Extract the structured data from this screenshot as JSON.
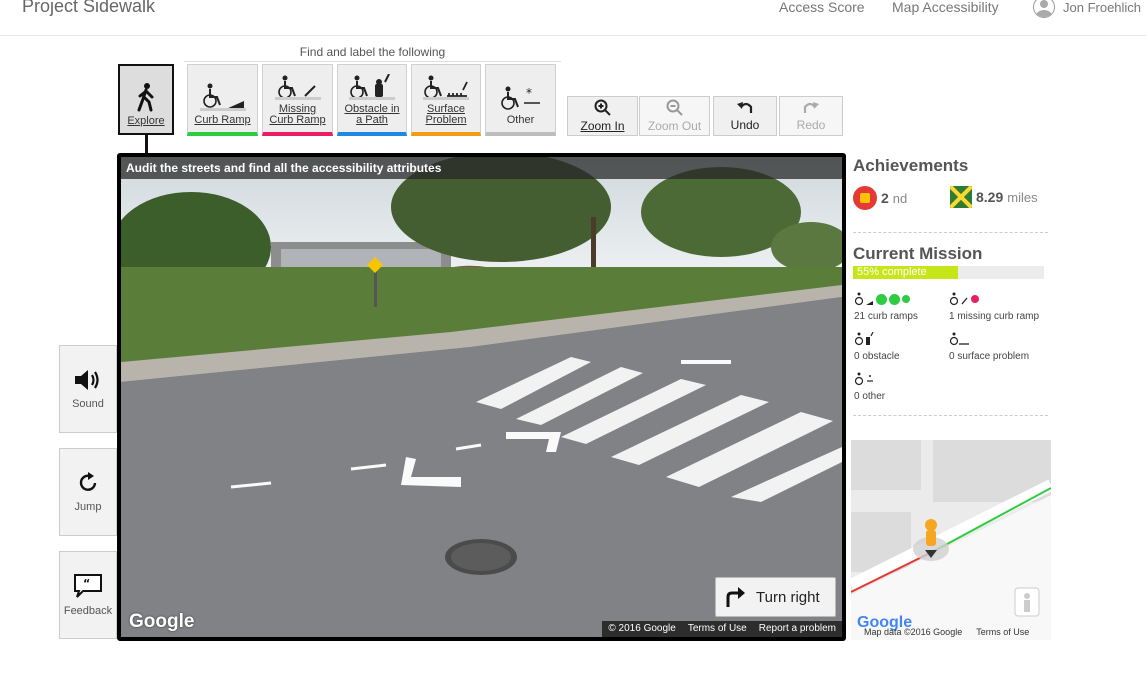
{
  "header": {
    "brand": "Project Sidewalk",
    "nav": {
      "access_score": "Access Score",
      "map_accessibility": "Map Accessibility"
    },
    "user_name": "Jon Froehlich"
  },
  "toolbar": {
    "find_label": "Find and label the following",
    "explore": "Explore",
    "curb_ramp": "Curb Ramp",
    "missing_curb_ramp_l1": "Missing",
    "missing_curb_ramp_l2": "Curb Ramp",
    "obstacle_l1": "Obstacle in",
    "obstacle_l2": "a Path",
    "surface_l1": "Surface",
    "surface_l2": "Problem",
    "other": "Other",
    "zoom_in": "Zoom In",
    "zoom_out": "Zoom Out",
    "undo": "Undo",
    "redo": "Redo"
  },
  "side": {
    "sound": "Sound",
    "jump": "Jump",
    "feedback": "Feedback"
  },
  "pano": {
    "banner": "Audit the streets and find all the accessibility attributes",
    "turn_right": "Turn right",
    "google": "Google",
    "copyright": "© 2016 Google",
    "terms": "Terms of Use",
    "report": "Report a problem"
  },
  "achievements": {
    "title": "Achievements",
    "rank_num": "2",
    "rank_suffix": "nd",
    "miles_num": "8.29",
    "miles_unit": "miles"
  },
  "mission": {
    "title": "Current Mission",
    "progress_label": "55% complete",
    "progress_fraction": 0.55,
    "curb_ramps": "21 curb ramps",
    "missing_curb_ramp": "1 missing curb ramp",
    "obstacle": "0 obstacle",
    "surface_problem": "0 surface problem",
    "other": "0 other"
  },
  "minimap": {
    "google": "Google",
    "map_data": "Map data ©2016 Google",
    "terms": "Terms of Use"
  },
  "colors": {
    "curb_ramp": "#2ecc40",
    "missing_curb_ramp": "#e91e63",
    "obstacle": "#1e88e5",
    "surface_problem": "#f39c12",
    "progress": "#c6e61a"
  }
}
